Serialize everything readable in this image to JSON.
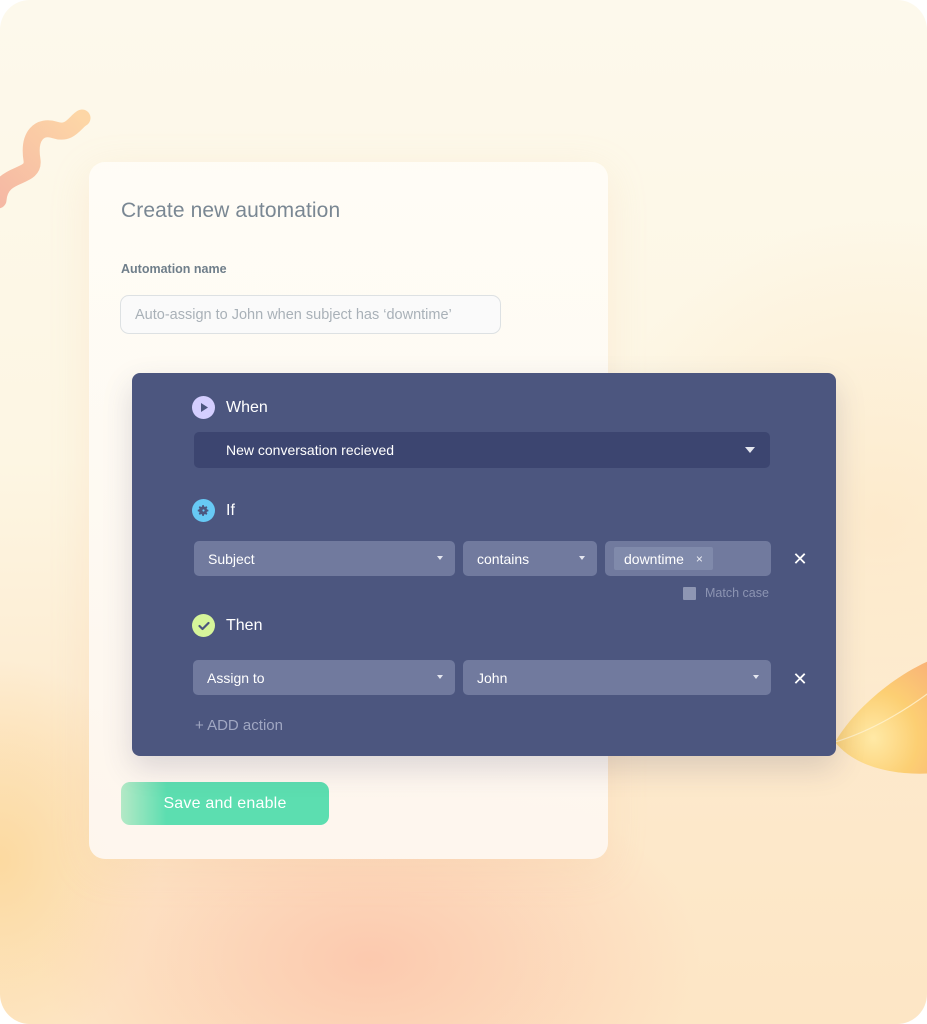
{
  "card": {
    "title": "Create new automation",
    "name_label": "Automation name",
    "name_placeholder": "Auto-assign to John when subject has ‘downtime’",
    "save_button": "Save and enable"
  },
  "rules": {
    "when": {
      "label": "When",
      "icon": "play-icon",
      "trigger": "New conversation recieved"
    },
    "if": {
      "label": "If",
      "icon": "gear-icon",
      "field": "Subject",
      "operator": "contains",
      "tags": [
        "downtime"
      ],
      "tag_remove": "×",
      "match_case_label": "Match case",
      "match_case_checked": false,
      "remove": "✕"
    },
    "then": {
      "label": "Then",
      "icon": "check-icon",
      "action": "Assign to",
      "target": "John",
      "remove": "✕"
    },
    "add_action": "+ ADD action"
  },
  "colors": {
    "panel": "#4c567f",
    "select": "#717a9e",
    "trigger_select": "#3c4570",
    "save_button": "#5cdeb0",
    "when_badge": "#d4ceff",
    "if_badge": "#67c9f5",
    "then_badge": "#d6f59a"
  }
}
